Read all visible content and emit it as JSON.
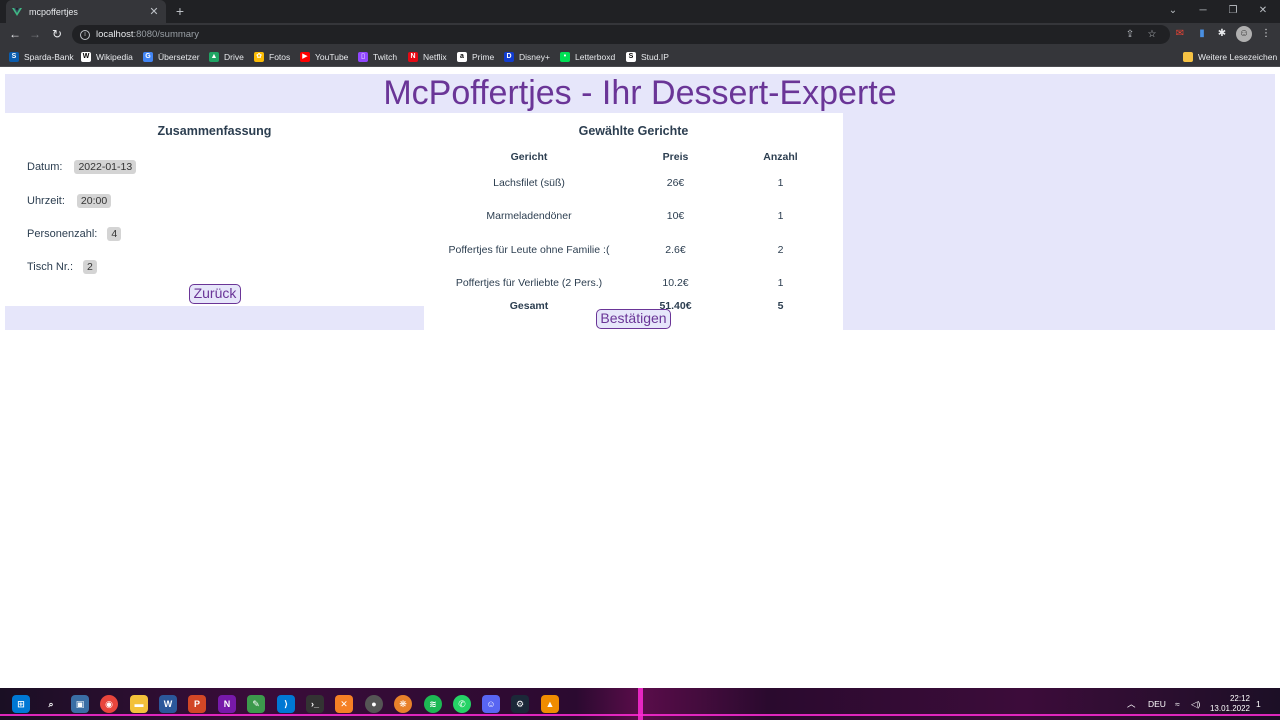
{
  "browser": {
    "tab_title": "mcpoffertjes",
    "tab_close": "✕",
    "new_tab": "+",
    "url_host": "localhost",
    "url_path": ":8080/summary",
    "bookmarks": [
      {
        "label": "Sparda-Bank",
        "icon": "bank-icon",
        "color": "#0a5cad"
      },
      {
        "label": "Wikipedia",
        "icon": "wikipedia-icon",
        "color": "#ffffff"
      },
      {
        "label": "Übersetzer",
        "icon": "translate-icon",
        "color": "#4285f4"
      },
      {
        "label": "Drive",
        "icon": "drive-icon",
        "color": "#1fa463"
      },
      {
        "label": "Fotos",
        "icon": "photos-icon",
        "color": "#fbbc04"
      },
      {
        "label": "YouTube",
        "icon": "youtube-icon",
        "color": "#ff0000"
      },
      {
        "label": "Twitch",
        "icon": "twitch-icon",
        "color": "#9146ff"
      },
      {
        "label": "Netflix",
        "icon": "netflix-icon",
        "color": "#e50914"
      },
      {
        "label": "Prime",
        "icon": "prime-icon",
        "color": "#ffffff"
      },
      {
        "label": "Disney+",
        "icon": "disney-icon",
        "color": "#113ccf"
      },
      {
        "label": "Letterboxd",
        "icon": "letterboxd-icon",
        "color": "#00e054"
      },
      {
        "label": "Stud.IP",
        "icon": "studip-icon",
        "color": "#ffffff"
      }
    ],
    "other_bookmarks": "Weitere Lesezeichen"
  },
  "app": {
    "title": "McPoffertjes - Ihr Dessert-Experte",
    "summary": {
      "heading": "Zusammenfassung",
      "date_label": "Datum:",
      "date_value": "2022-01-13",
      "time_label": "Uhrzeit:",
      "time_value": "20:00",
      "persons_label": "Personenzahl:",
      "persons_value": "4",
      "table_label": "Tisch Nr.:",
      "table_value": "2",
      "back_button": "Zurück"
    },
    "dishes": {
      "heading": "Gewählte Gerichte",
      "columns": [
        "Gericht",
        "Preis",
        "Anzahl"
      ],
      "rows": [
        {
          "name": "Lachsfilet (süß)",
          "price": "26€",
          "count": "1"
        },
        {
          "name": "Marmeladendöner",
          "price": "10€",
          "count": "1"
        },
        {
          "name": "Poffertjes für Leute ohne Familie :(",
          "price": "2.6€",
          "count": "2"
        },
        {
          "name": "Poffertjes für Verliebte (2 Pers.)",
          "price": "10.2€",
          "count": "1"
        }
      ],
      "total": {
        "label": "Gesamt",
        "price": "51.40€",
        "count": "5"
      },
      "confirm_button": "Bestätigen"
    }
  },
  "taskbar": {
    "language": "DEU",
    "time": "22:12",
    "date": "13.01.2022",
    "notification_count": "1"
  }
}
